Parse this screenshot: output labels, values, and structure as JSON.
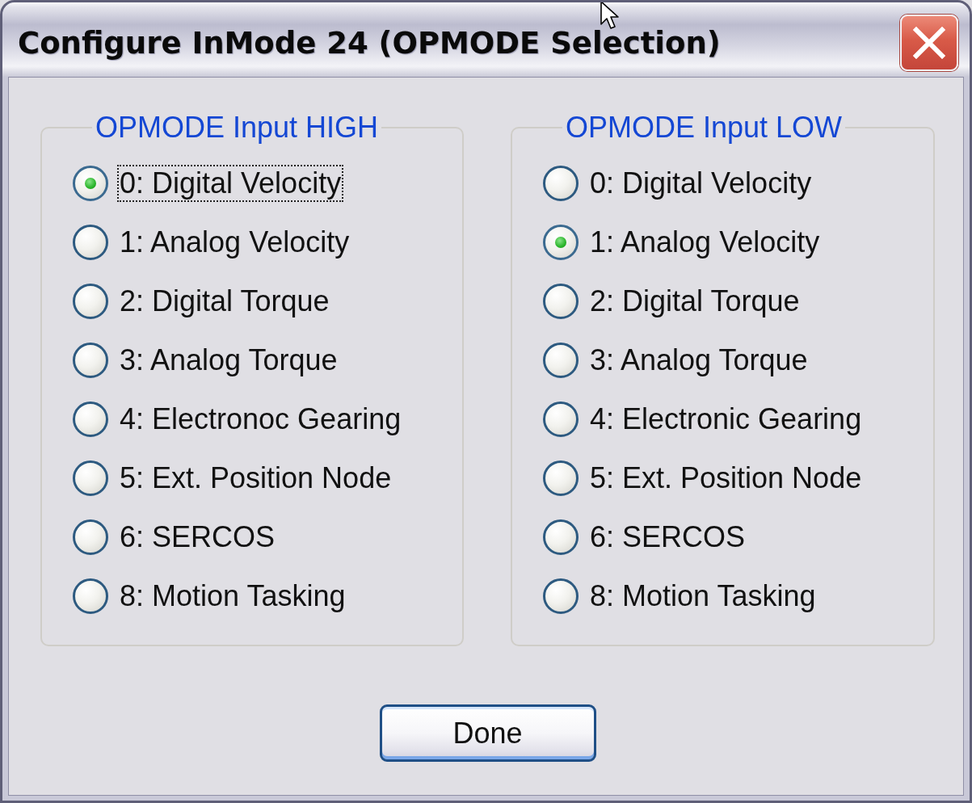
{
  "window": {
    "title": "Configure InMode 24 (OPMODE Selection)"
  },
  "groups": [
    {
      "title": "OPMODE Input HIGH",
      "options": [
        {
          "label": "0: Digital Velocity",
          "selected": true,
          "focused": true
        },
        {
          "label": "1: Analog Velocity",
          "selected": false,
          "focused": false
        },
        {
          "label": "2: Digital Torque",
          "selected": false,
          "focused": false
        },
        {
          "label": "3: Analog Torque",
          "selected": false,
          "focused": false
        },
        {
          "label": "4: Electronoc Gearing",
          "selected": false,
          "focused": false
        },
        {
          "label": "5: Ext. Position Node",
          "selected": false,
          "focused": false
        },
        {
          "label": "6: SERCOS",
          "selected": false,
          "focused": false
        },
        {
          "label": "8: Motion Tasking",
          "selected": false,
          "focused": false
        }
      ]
    },
    {
      "title": "OPMODE Input LOW",
      "options": [
        {
          "label": "0: Digital Velocity",
          "selected": false,
          "focused": false
        },
        {
          "label": "1: Analog Velocity",
          "selected": true,
          "focused": false
        },
        {
          "label": "2: Digital Torque",
          "selected": false,
          "focused": false
        },
        {
          "label": "3: Analog Torque",
          "selected": false,
          "focused": false
        },
        {
          "label": "4: Electronic Gearing",
          "selected": false,
          "focused": false
        },
        {
          "label": "5: Ext. Position Node",
          "selected": false,
          "focused": false
        },
        {
          "label": "6: SERCOS",
          "selected": false,
          "focused": false
        },
        {
          "label": "8: Motion Tasking",
          "selected": false,
          "focused": false
        }
      ]
    }
  ],
  "button": {
    "label": "Done",
    "default": true
  }
}
